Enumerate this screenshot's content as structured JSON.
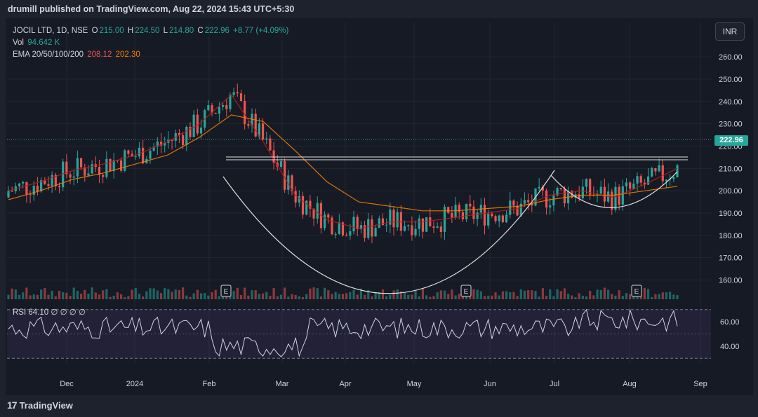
{
  "header": {
    "published": "drumill published on TradingView.com, Aug 22, 2024 15:43 UTC+5:30"
  },
  "legend": {
    "symbol": "JOCIL LTD, 1D, NSE",
    "o_label": "O",
    "o_value": "215.00",
    "h_label": "H",
    "h_value": "224.50",
    "l_label": "L",
    "l_value": "214.80",
    "c_label": "C",
    "c_value": "222.96",
    "change": "+8.77 (+4.09%)",
    "vol_label": "Vol",
    "vol_value": "94.642 K",
    "ema_label": "EMA 20/50/100/200",
    "ema1_value": "208.12",
    "ema2_value": "202.30"
  },
  "currency_button": "INR",
  "last_price_tag": "222.96",
  "rsi": {
    "label": "RSI",
    "value": "64.10",
    "params": "∅ ∅ ∅ ∅"
  },
  "footer": {
    "brand": "TradingView",
    "logo_text": "17"
  },
  "colors": {
    "up": "#26a69a",
    "down": "#ef5350",
    "ema_fast": "#b71c1c",
    "ema_slow": "#f57c00",
    "rsi_line": "#d1d4dc",
    "background": "#161a25"
  },
  "chart_data": {
    "type": "candlestick",
    "x_tick_labels": [
      "Dec",
      "2024",
      "Feb",
      "Mar",
      "Apr",
      "May",
      "Jun",
      "Jul",
      "Aug",
      "Sep"
    ],
    "y_tick_labels": [
      "260.00",
      "250.00",
      "240.00",
      "230.00",
      "220.00",
      "210.00",
      "200.00",
      "190.00",
      "180.00",
      "170.00",
      "160.00"
    ],
    "ylim": [
      152,
      266
    ],
    "rsi_ticks": [
      "60.00",
      "40.00"
    ],
    "rsi_ylim": [
      25,
      75
    ],
    "rsi_bands": [
      70,
      30
    ],
    "earnings_marker": "E",
    "earnings_months": [
      "Feb",
      "May",
      "Aug"
    ],
    "series": [
      {
        "name": "EMA 20",
        "values": [
          200,
          204,
          209,
          212,
          216,
          222,
          230,
          243,
          222,
          198,
          187,
          183,
          186,
          186,
          188,
          190,
          192,
          198,
          200,
          197,
          203,
          210
        ]
      },
      {
        "name": "EMA 50",
        "values": [
          196,
          200,
          205,
          208,
          212,
          216,
          224,
          234,
          231,
          218,
          204,
          195,
          193,
          191,
          191,
          192,
          193,
          196,
          198,
          198,
          200,
          202
        ]
      }
    ],
    "pattern": "cup and handle",
    "resistance": 214.5,
    "last_close": 222.96
  }
}
